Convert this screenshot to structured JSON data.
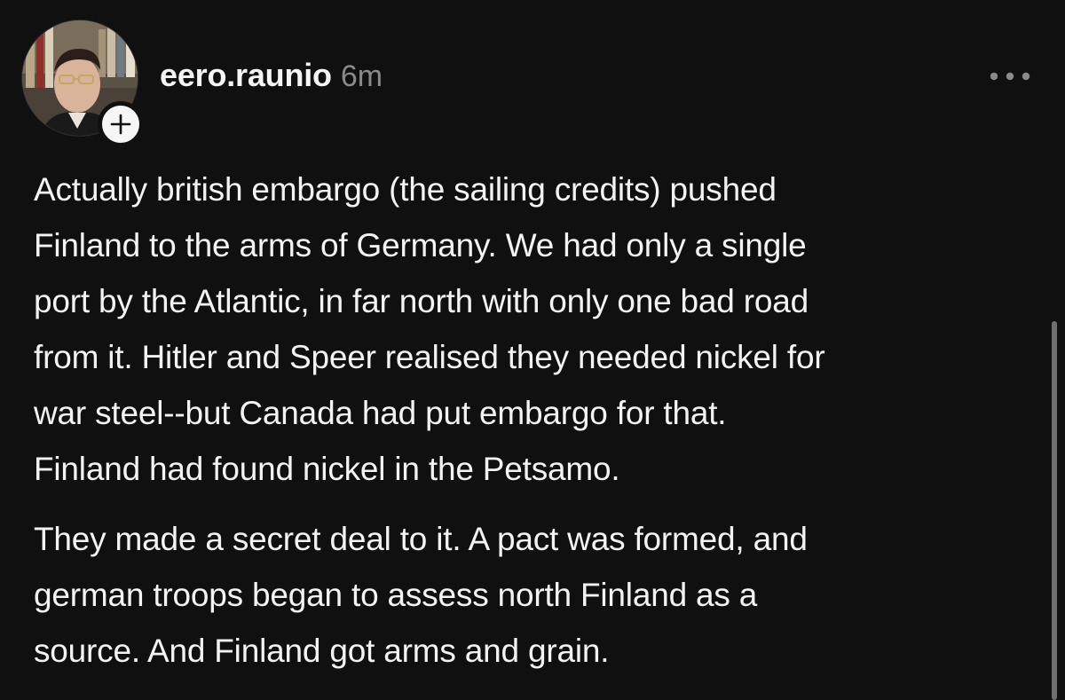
{
  "post": {
    "username": "eero.raunio",
    "timestamp": "6m",
    "avatar_icon": "profile-photo",
    "follow_icon": "plus-icon",
    "more_icon": "more-horizontal-icon",
    "paragraphs": [
      {
        "lines": [
          "Actually british embargo (the sailing credits) pushed",
          "Finland to the arms of Germany. We had only a single",
          "port by the Atlantic, in far north with only one bad road",
          "from it. Hitler and Speer realised they needed nickel for",
          "war steel--but Canada had put embargo for that.",
          "Finland had found nickel in the Petsamo."
        ]
      },
      {
        "lines": [
          "They made a secret deal to it. A pact was formed, and",
          "german troops began to assess north Finland as a",
          "source. And Finland got arms and grain."
        ]
      }
    ]
  },
  "colors": {
    "background": "#101010",
    "text": "#f3f3f3",
    "muted": "#8a8a8a"
  }
}
